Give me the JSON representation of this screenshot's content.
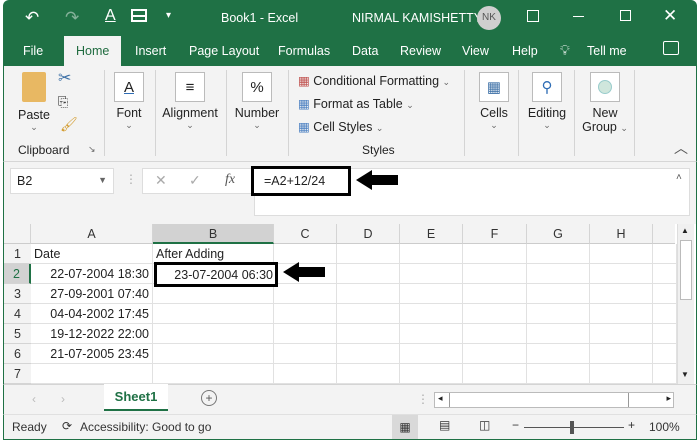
{
  "titlebar": {
    "title": "Book1  -  Excel",
    "user": "NIRMAL KAMISHETTY",
    "initials": "NK"
  },
  "tabs": [
    "File",
    "Home",
    "Insert",
    "Page Layout",
    "Formulas",
    "Data",
    "Review",
    "View",
    "Help",
    "Tell me"
  ],
  "ribbon": {
    "paste": "Paste",
    "clipboard": "Clipboard",
    "font": "Font",
    "alignment": "Alignment",
    "number": "Number",
    "conditional_formatting": "Conditional Formatting",
    "format_as_table": "Format as Table",
    "cell_styles": "Cell Styles",
    "styles": "Styles",
    "cells": "Cells",
    "editing": "Editing",
    "new_group_1": "New",
    "new_group_2": "Group"
  },
  "formula_bar": {
    "name_box": "B2",
    "formula": "=A2+12/24"
  },
  "columns": [
    "A",
    "B",
    "C",
    "D",
    "E",
    "F",
    "G",
    "H"
  ],
  "rows": [
    "1",
    "2",
    "3",
    "4",
    "5",
    "6",
    "7"
  ],
  "cells": {
    "A1": "Date",
    "B1": "After Adding",
    "A2": "22-07-2004 18:30",
    "B2": "23-07-2004 06:30",
    "A3": "27-09-2001 07:40",
    "A4": "04-04-2002 17:45",
    "A5": "19-12-2022 22:00",
    "A6": "21-07-2005 23:45"
  },
  "sheet_tab": "Sheet1",
  "status": {
    "ready": "Ready",
    "accessibility": "Accessibility: Good to go",
    "zoom": "100%"
  },
  "colors": {
    "accent": "#1f7145"
  }
}
